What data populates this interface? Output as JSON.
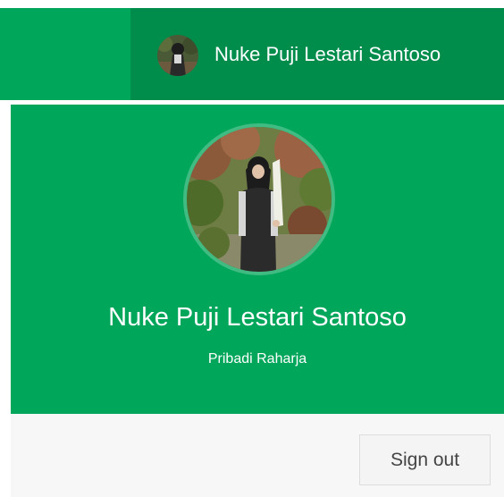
{
  "navbar": {
    "user_name": "Nuke Puji Lestari Santoso"
  },
  "user_header": {
    "name": "Nuke Puji Lestari Santoso",
    "subtitle": "Pribadi Raharja"
  },
  "user_footer": {
    "signout_label": "Sign out"
  },
  "colors": {
    "header_green": "#00a65a",
    "navbar_user_green": "#008d4c",
    "footer_bg": "#f7f7f7"
  }
}
